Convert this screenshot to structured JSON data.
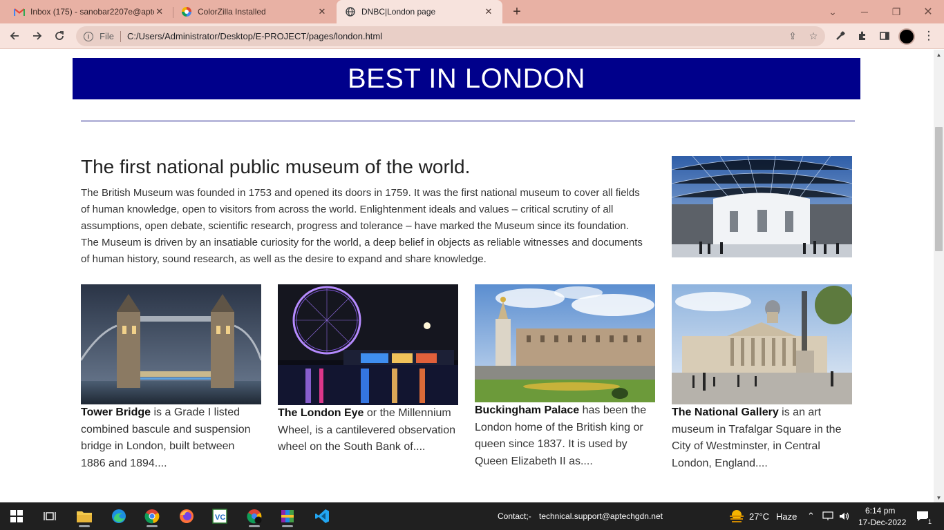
{
  "browser": {
    "tabs": [
      {
        "title": "Inbox (175) - sanobar2207e@aptech",
        "icon": "gmail-icon"
      },
      {
        "title": "ColorZilla Installed",
        "icon": "colorzilla-icon"
      },
      {
        "title": "DNBC|London page",
        "icon": "globe-icon",
        "active": true
      }
    ],
    "address": {
      "scheme": "File",
      "url": "C:/Users/Administrator/Desktop/E-PROJECT/pages/london.html"
    }
  },
  "page": {
    "banner": "BEST IN LONDON",
    "heading": "The first national public museum of the world.",
    "intro": "The British Museum was founded in 1753 and opened its doors in 1759. It was the first national museum to cover all fields of human knowledge, open to visitors from across the world. Enlightenment ideals and values – critical scrutiny of all assumptions, open debate, scientific research, progress and tolerance – have marked the Museum since its foundation. The Museum is driven by an insatiable curiosity for the world, a deep belief in objects as reliable witnesses and documents of human history, sound research, as well as the desire to expand and share knowledge.",
    "cards": [
      {
        "name": "Tower Bridge",
        "text": " is a Grade I listed combined bascule and suspension bridge in London, built between 1886 and 1894...."
      },
      {
        "name": "The London Eye",
        "text": " or the Millennium Wheel, is a cantilevered observation wheel on the South Bank of...."
      },
      {
        "name": "Buckingham Palace",
        "text": " has been the London home of the British king or queen since 1837. It is used by Queen Elizabeth II as...."
      },
      {
        "name": "The National Gallery",
        "text": " is an art museum in Trafalgar Square in the City of Westminster, in Central London, England...."
      }
    ]
  },
  "taskbar": {
    "contact_label": "Contact;-",
    "contact_email": "technical.support@aptechgdn.net",
    "weather": "27°C",
    "weather_desc": "Haze",
    "time": "6:14 pm",
    "date": "17-Dec-2022",
    "notification_count": "1"
  },
  "colors": {
    "banner": "#00008b",
    "tabstrip": "#e8b1a4",
    "toolbar": "#f7e3dd",
    "taskbar": "#202020"
  }
}
